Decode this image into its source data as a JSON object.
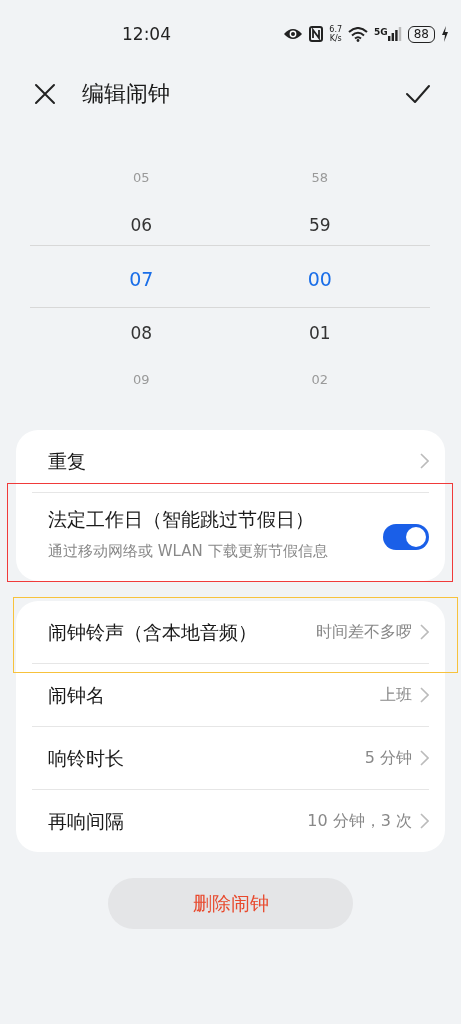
{
  "status_bar": {
    "time": "12:04",
    "speed_value": "6.7",
    "speed_unit": "K/s",
    "network": "5G",
    "battery": "88"
  },
  "header": {
    "title": "编辑闹钟"
  },
  "picker": {
    "columns": [
      {
        "values": [
          {
            "text": "05",
            "selected": false
          },
          {
            "text": "06",
            "selected": false
          },
          {
            "text": "07",
            "selected": true
          },
          {
            "text": "08",
            "selected": false
          },
          {
            "text": "09",
            "selected": false
          }
        ]
      },
      {
        "values": [
          {
            "text": "58",
            "selected": false
          },
          {
            "text": "59",
            "selected": false
          },
          {
            "text": "00",
            "selected": true
          },
          {
            "text": "01",
            "selected": false
          },
          {
            "text": "02",
            "selected": false
          }
        ]
      }
    ]
  },
  "groups": [
    {
      "rows": [
        {
          "kind": "link",
          "label": "重复"
        },
        {
          "kind": "toggle",
          "label": "法定工作日（智能跳过节假日）",
          "description": "通过移动网络或 WLAN 下载更新节假信息",
          "on": true,
          "highlight": {
            "color": "#f03a3a"
          }
        }
      ]
    },
    {
      "rows": [
        {
          "kind": "link",
          "label": "闹钟铃声（含本地音频）",
          "value": "时间差不多啰",
          "highlight": {
            "color": "#f7c23c"
          }
        },
        {
          "kind": "link",
          "label": "闹钟名",
          "value": "上班"
        },
        {
          "kind": "link",
          "label": "响铃时长",
          "value": "5 分钟"
        },
        {
          "kind": "link",
          "label": "再响间隔",
          "value": "10 分钟，3 次"
        }
      ]
    }
  ],
  "delete_button": "删除闹钟"
}
